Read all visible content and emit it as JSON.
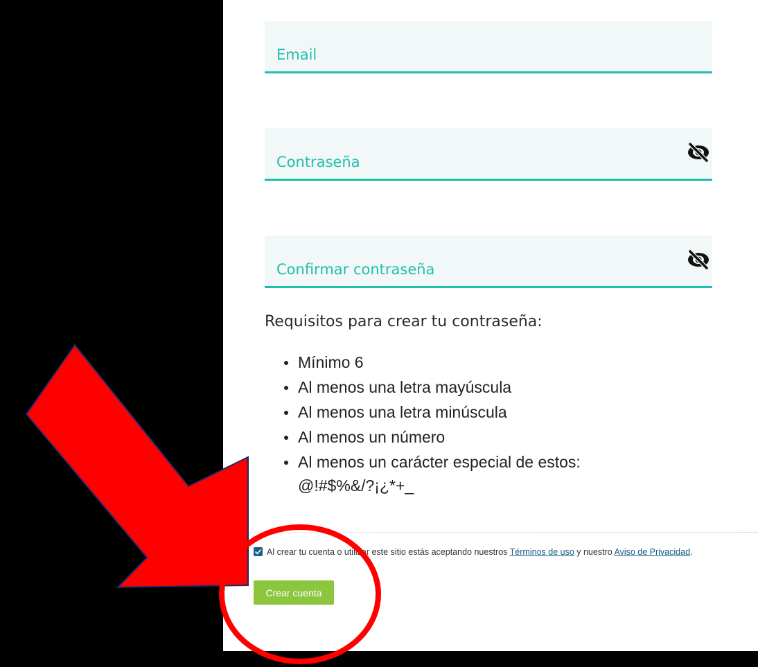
{
  "form": {
    "email_label": "Email",
    "password_label": "Contraseña",
    "confirm_label": "Confirmar contraseña"
  },
  "requirements": {
    "title": "Requisitos para crear tu contraseña:",
    "items": [
      "Mínimo 6",
      "Al menos una letra mayúscula",
      "Al menos una letra minúscula",
      "Al menos un número",
      "Al menos un carácter especial de estos:",
      "@!#$%&/?¡¿*+_"
    ]
  },
  "terms": {
    "checked": true,
    "text_before": "Al crear tu cuenta o utilizar este sitio estás aceptando nuestros ",
    "terms_link": "Términos de uso",
    "text_middle": " y nuestro ",
    "privacy_link": "Aviso de Privacidad",
    "text_after": "."
  },
  "submit_label": "Crear cuenta",
  "icons": {
    "toggle_password": "eye-slash-icon",
    "checkbox": "checkmark-icon"
  },
  "annotations": {
    "arrow": "red-arrow",
    "circle": "red-circle"
  },
  "colors": {
    "accent": "#1fbfad",
    "field_bg": "#f2f7f8",
    "button": "#8cc63f",
    "checkbox": "#1d5f86",
    "annotation": "#ff0000"
  }
}
